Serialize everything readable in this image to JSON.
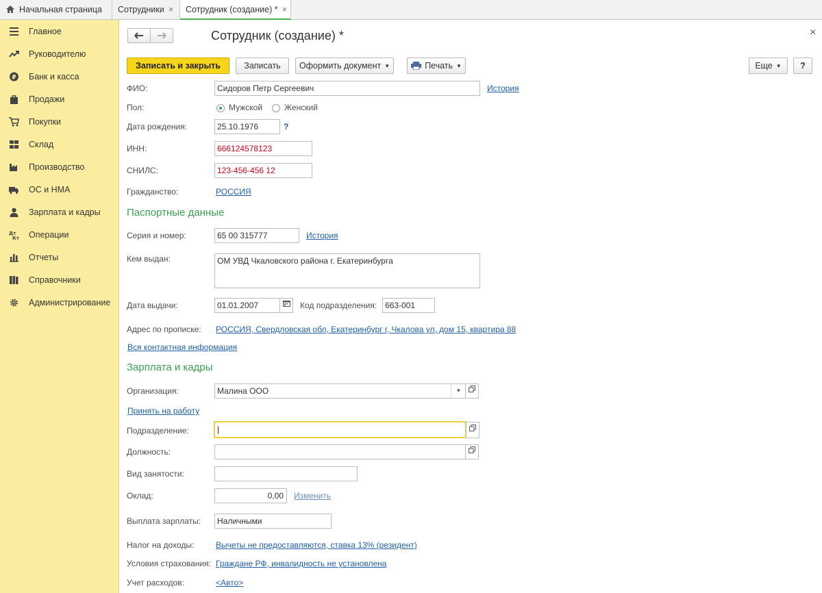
{
  "tabs": {
    "home": "Начальная страница",
    "employees": "Сотрудники",
    "current": "Сотрудник (создание) *",
    "close_glyph": "×"
  },
  "sidebar": {
    "items": [
      {
        "label": "Главное",
        "icon": "menu-lines-icon"
      },
      {
        "label": "Руководителю",
        "icon": "trend-chart-icon"
      },
      {
        "label": "Банк и касса",
        "icon": "ruble-coin-icon"
      },
      {
        "label": "Продажи",
        "icon": "shopping-bag-icon"
      },
      {
        "label": "Покупки",
        "icon": "cart-icon"
      },
      {
        "label": "Склад",
        "icon": "warehouse-grid-icon"
      },
      {
        "label": "Производство",
        "icon": "factory-icon"
      },
      {
        "label": "ОС и НМА",
        "icon": "truck-icon"
      },
      {
        "label": "Зарплата и кадры",
        "icon": "person-icon"
      },
      {
        "label": "Операции",
        "icon": "debit-credit-icon"
      },
      {
        "label": "Отчеты",
        "icon": "bar-chart-icon"
      },
      {
        "label": "Справочники",
        "icon": "books-icon"
      },
      {
        "label": "Администрирование",
        "icon": "gear-icon"
      }
    ]
  },
  "header": {
    "title": "Сотрудник (создание) *",
    "close_glyph": "×"
  },
  "toolbar": {
    "save_close": "Записать и закрыть",
    "save": "Записать",
    "create_doc": "Оформить документ",
    "print": "Печать",
    "more": "Еще",
    "help": "?"
  },
  "form": {
    "fio_label": "ФИО:",
    "fio_value": "Сидоров Петр Сергеевич",
    "fio_history": "История",
    "sex_label": "Пол:",
    "sex_male": "Мужской",
    "sex_female": "Женский",
    "birth_label": "Дата рождения:",
    "birth_value": "25.10.1976",
    "birth_help": "?",
    "inn_label": "ИНН:",
    "inn_value": "666124578123",
    "snils_label": "СНИЛС:",
    "snils_value": "123-456-456 12",
    "citizenship_label": "Гражданство:",
    "citizenship_value": "РОССИЯ"
  },
  "passport": {
    "section_title": "Паспортные данные",
    "series_label": "Серия и номер:",
    "series_value": "65 00 315777",
    "series_history": "История",
    "issued_by_label": "Кем выдан:",
    "issued_by_value": "ОМ УВД Чкаловского района г. Екатеринбурга",
    "issue_date_label": "Дата выдачи:",
    "issue_date_value": "01.01.2007",
    "dept_code_label": "Код подразделения:",
    "dept_code_value": "663-001",
    "address_label": "Адрес по прописке:",
    "address_value": "РОССИЯ, Свердловская обл, Екатеринбург г, Чкалова ул, дом 15, квартира 88",
    "all_contacts": "Вся контактная информация"
  },
  "salary": {
    "section_title": "Зарплата и кадры",
    "org_label": "Организация:",
    "org_value": "Малина ООО",
    "hire_link": "Принять на работу",
    "division_label": "Подразделение:",
    "division_value": "",
    "position_label": "Должность:",
    "position_value": "",
    "employment_label": "Вид занятости:",
    "employment_value": "",
    "salary_label": "Оклад:",
    "salary_value": "0,00",
    "salary_change": "Изменить",
    "payout_label": "Выплата зарплаты:",
    "payout_value": "Наличными",
    "tax_label": "Налог на доходы:",
    "tax_value": "Вычеты не предоставляются, ставка 13% (резидент)",
    "insurance_label": "Условия страхования:",
    "insurance_value": "Граждане РФ, инвалидность не установлена",
    "expenses_label": "Учет расходов:",
    "expenses_value": "<Авто>"
  },
  "colors": {
    "accent_yellow": "#f6d51a",
    "sidebar_bg": "#fbeda0",
    "section_green": "#3aa050",
    "link_blue": "#1f5fa8",
    "error_red": "#d0021b"
  }
}
